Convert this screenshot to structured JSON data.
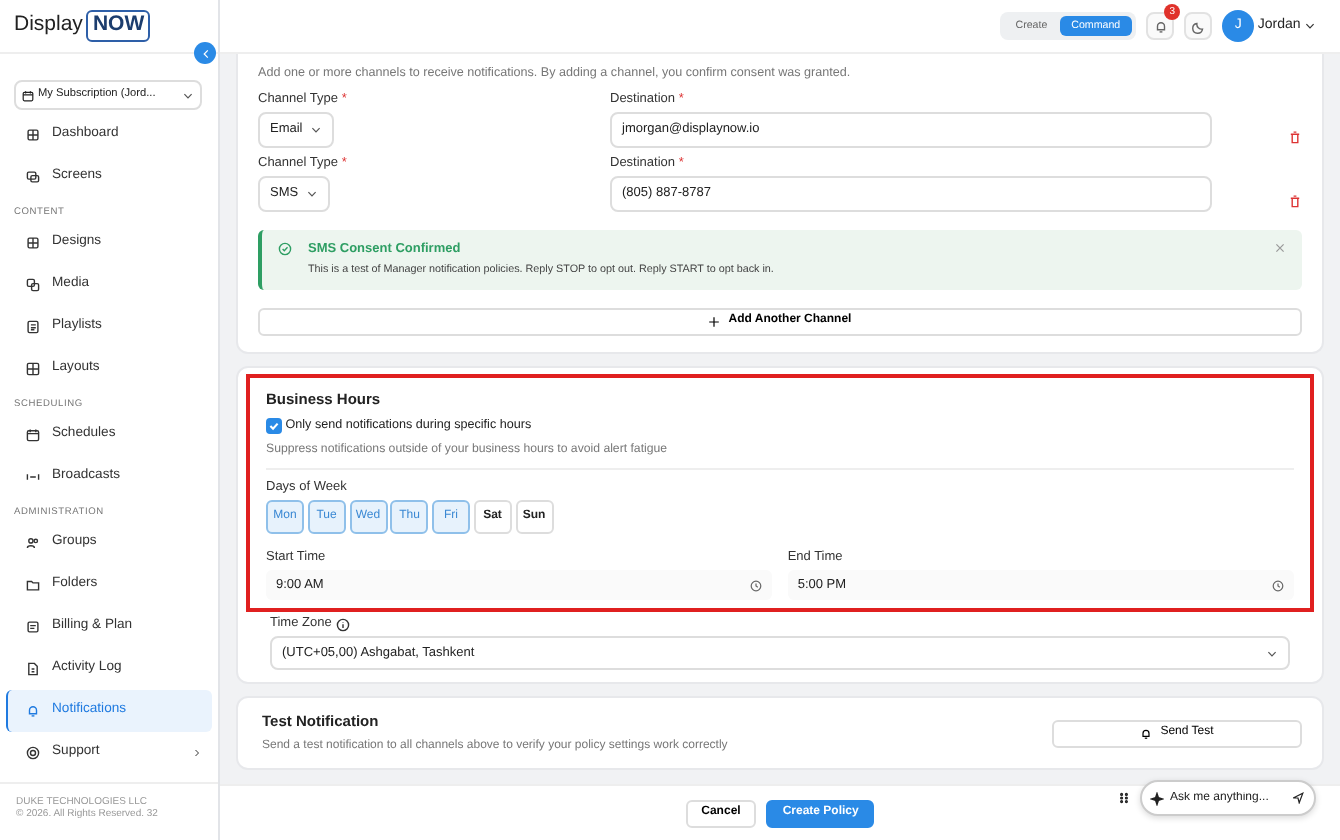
{
  "sidebar": {
    "logo": {
      "text": "Display",
      "boxed": "NOW"
    },
    "subscription": "My Subscription (Jord...",
    "sections": [
      {
        "items": [
          {
            "label": "Dashboard",
            "selected": false,
            "has_submenu": false
          },
          {
            "label": "Screens",
            "selected": false,
            "has_submenu": false
          }
        ]
      },
      {
        "heading": "CONTENT",
        "items": [
          {
            "label": "Designs",
            "selected": false,
            "has_submenu": false
          },
          {
            "label": "Media",
            "selected": false,
            "has_submenu": false
          },
          {
            "label": "Playlists",
            "selected": false,
            "has_submenu": false
          },
          {
            "label": "Layouts",
            "selected": false,
            "has_submenu": false
          }
        ]
      },
      {
        "heading": "SCHEDULING",
        "items": [
          {
            "label": "Schedules",
            "selected": false,
            "has_submenu": false
          },
          {
            "label": "Broadcasts",
            "selected": false,
            "has_submenu": false
          }
        ]
      },
      {
        "heading": "ADMINISTRATION",
        "items": [
          {
            "label": "Groups",
            "selected": false,
            "has_submenu": false
          },
          {
            "label": "Folders",
            "selected": false,
            "has_submenu": false
          },
          {
            "label": "Billing & Plan",
            "selected": false,
            "has_submenu": false
          },
          {
            "label": "Activity Log",
            "selected": false,
            "has_submenu": false
          },
          {
            "label": "Notifications",
            "selected": true,
            "has_submenu": false
          },
          {
            "label": "Support",
            "selected": false,
            "has_submenu": true
          }
        ]
      }
    ],
    "footer": [
      "DUKE TECHNOLOGIES LLC",
      "© 2026. All Rights Reserved. 32"
    ]
  },
  "header": {
    "modes": [
      {
        "label": "Create",
        "selected": false
      },
      {
        "label": "Command",
        "selected": true
      }
    ],
    "notification_count": "3",
    "user": {
      "initial": "J",
      "name": "Jordan"
    }
  },
  "channels_card": {
    "intro": "Add one or more channels to receive notifications. By adding a channel, you confirm consent was granted.",
    "channels": [
      {
        "type_label": "Channel Type",
        "type": "Email",
        "destination_label": "Destination",
        "destination": "jmorgan@displaynow.io",
        "required_mark": "*"
      },
      {
        "type_label": "Channel Type",
        "type": "SMS",
        "destination_label": "Destination",
        "destination": "(805) 887-8787",
        "required_mark": "*"
      }
    ],
    "alert": {
      "title": "SMS Consent Confirmed",
      "message": "This is a test of Manager notification policies. Reply STOP to opt out. Reply START to opt back in."
    },
    "add_button": "Add Another Channel"
  },
  "business_hours": {
    "highlighted": true,
    "title": "Business Hours",
    "checkbox": {
      "label": "Only send notifications during specific hours",
      "checked": true
    },
    "hint": "Suppress notifications outside of your business hours to avoid alert fatigue",
    "days_label": "Days of Week",
    "days": [
      {
        "label": "Mon",
        "selected": true
      },
      {
        "label": "Tue",
        "selected": true
      },
      {
        "label": "Wed",
        "selected": true
      },
      {
        "label": "Thu",
        "selected": true
      },
      {
        "label": "Fri",
        "selected": true
      },
      {
        "label": "Sat",
        "selected": false
      },
      {
        "label": "Sun",
        "selected": false
      }
    ],
    "start_time": {
      "label": "Start Time",
      "value": "9:00 AM"
    },
    "end_time": {
      "label": "End Time",
      "value": "5:00 PM"
    }
  },
  "time_zone": {
    "label": "Time Zone",
    "value": "(UTC+05,00) Ashgabat, Tashkent"
  },
  "test_notification": {
    "title": "Test Notification",
    "description": "Send a test notification to all channels above to verify your policy settings work correctly",
    "button": "Send Test"
  },
  "chat": {
    "placeholder": "Ask me anything..."
  },
  "footer_buttons": [
    {
      "label": "Cancel",
      "kind": "secondary"
    },
    {
      "label": "Create Policy",
      "kind": "primary"
    }
  ]
}
